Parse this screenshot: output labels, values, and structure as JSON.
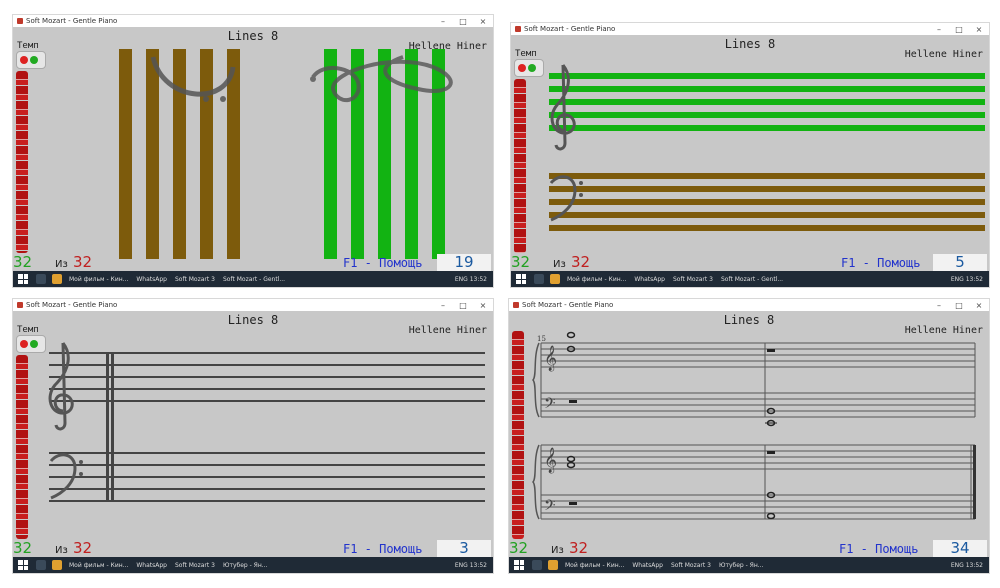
{
  "window": {
    "title": "Soft Mozart - Gentle Piano"
  },
  "song": {
    "title": "Lines 8",
    "composer": "Hellene Hiner"
  },
  "tempo": {
    "label": "Темп"
  },
  "counter": {
    "total": "32",
    "separator": "Из"
  },
  "help": {
    "label": "F1 - Помощь"
  },
  "panels": [
    {
      "current": "32",
      "page": "19"
    },
    {
      "current": "32",
      "page": "5"
    },
    {
      "current": "32",
      "page": "3"
    },
    {
      "current": "32",
      "page": "34"
    }
  ],
  "taskbar": {
    "items": [
      "Мой фильм - Кин...",
      "WhatsApp",
      "Soft Mozart 3",
      "Ютубер - Ян...",
      "Soft Mozart - Gentl..."
    ],
    "tray": "ENG 13:52"
  },
  "notes": {
    "measure_number": "15"
  },
  "colors": {
    "green": "#12b312",
    "brown": "#7d5b0c",
    "red": "#c02020",
    "help_blue": "#2233cc",
    "page_blue": "#1b5aa0",
    "grey_bg": "#c8c8c8"
  }
}
